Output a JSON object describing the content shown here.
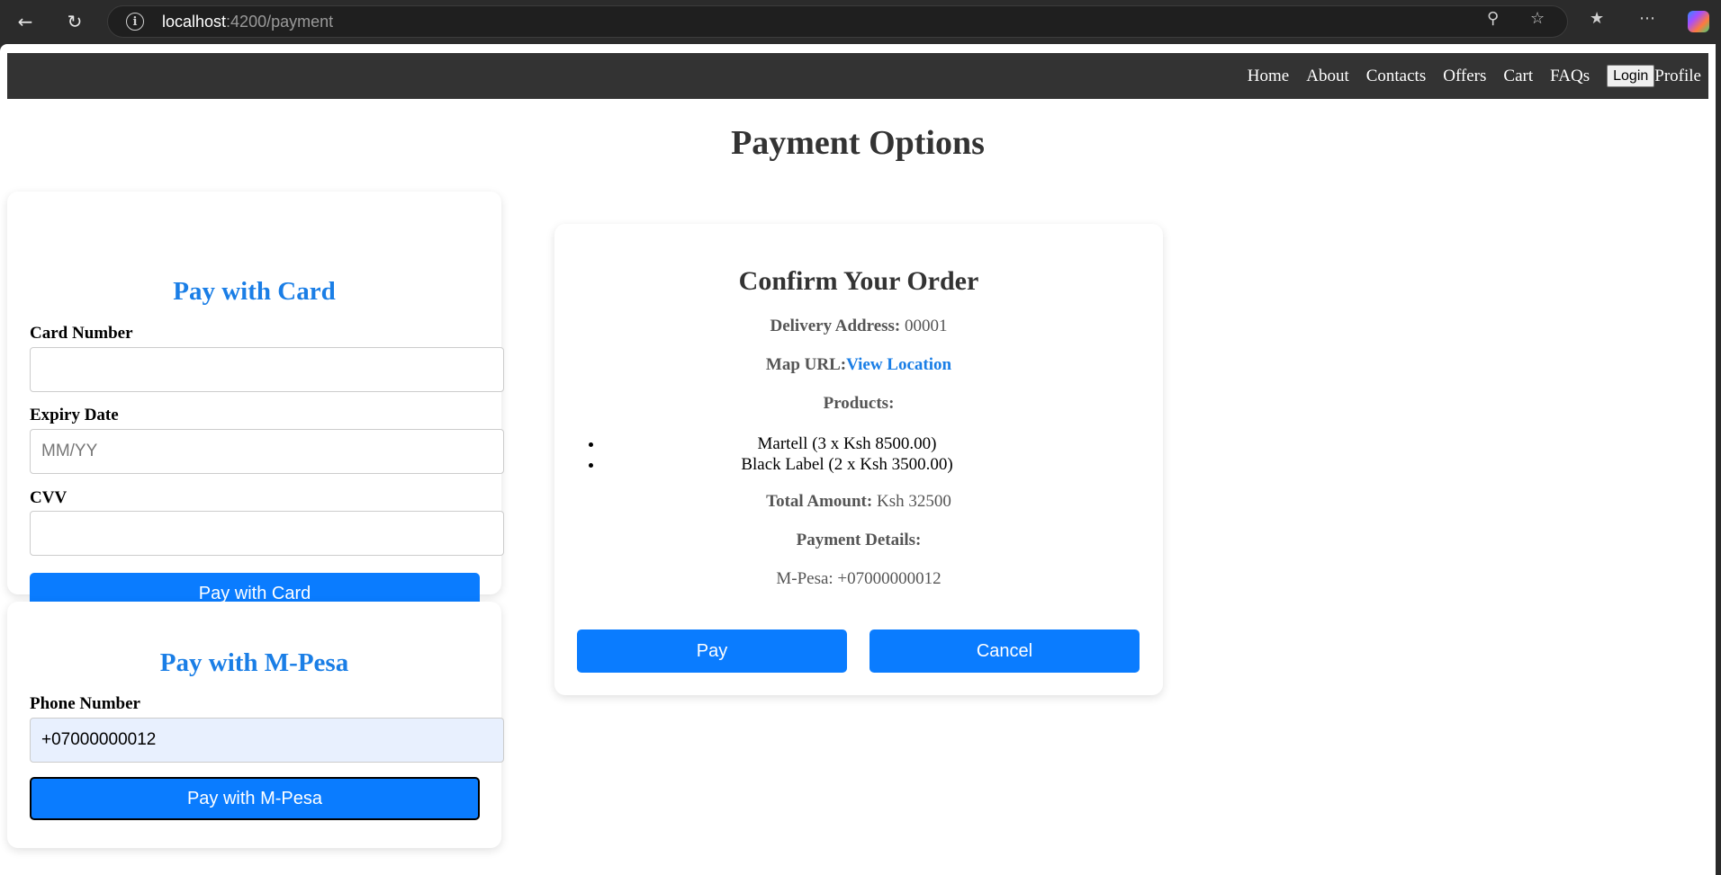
{
  "browser": {
    "url_host": "localhost",
    "url_path": ":4200/payment"
  },
  "nav": {
    "links": [
      "Home",
      "About",
      "Contacts",
      "Offers",
      "Cart",
      "FAQs"
    ],
    "login_label": "Login",
    "profile_label": "Profile"
  },
  "page": {
    "title": "Payment Options"
  },
  "card_payment": {
    "heading": "Pay with Card",
    "card_number_label": "Card Number",
    "card_number_value": "",
    "expiry_label": "Expiry Date",
    "expiry_placeholder": "MM/YY",
    "cvv_label": "CVV",
    "cvv_value": "",
    "button_label": "Pay with Card"
  },
  "mpesa_payment": {
    "heading": "Pay with M-Pesa",
    "phone_label": "Phone Number",
    "phone_value": "+07000000012",
    "button_label": "Pay with M-Pesa"
  },
  "confirm": {
    "heading": "Confirm Your Order",
    "delivery_label": "Delivery Address:",
    "delivery_value": "00001",
    "map_label": "Map URL:",
    "map_link": "View Location",
    "products_label": "Products:",
    "products": [
      "Martell (3 x Ksh 8500.00)",
      "Black Label (2 x Ksh 3500.00)"
    ],
    "total_label": "Total Amount:",
    "total_value": "Ksh 32500",
    "payment_details_label": "Payment Details:",
    "payment_details_value": "M-Pesa: +07000000012",
    "pay_label": "Pay",
    "cancel_label": "Cancel"
  },
  "colors": {
    "accent_blue": "#0a7cff",
    "heading_blue": "#1a7ee6",
    "navbar_bg": "#333333"
  }
}
